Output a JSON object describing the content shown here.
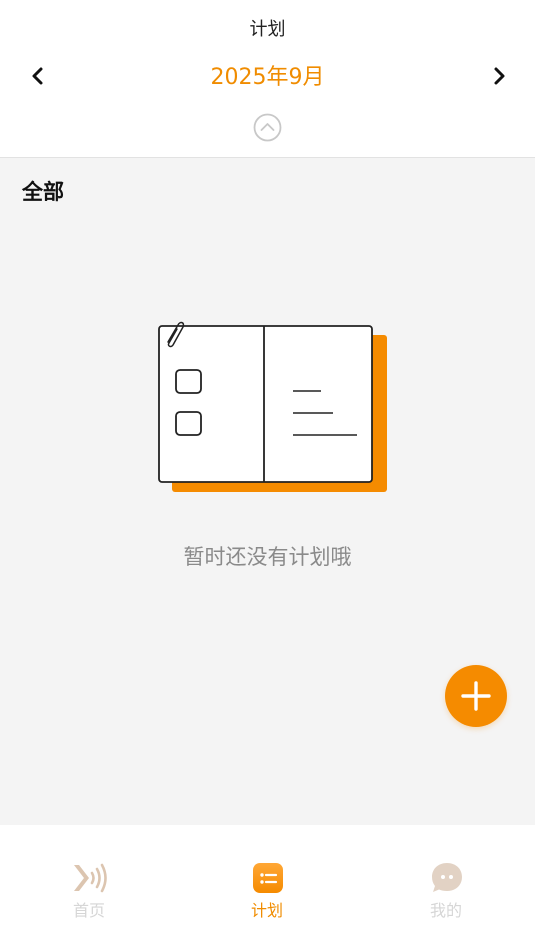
{
  "header": {
    "title": "计划",
    "month_label": "2025年9月",
    "prev_icon": "chevron-left-icon",
    "next_icon": "chevron-right-icon",
    "collapse_icon": "chevron-up-circle-icon"
  },
  "section": {
    "title": "全部"
  },
  "empty_state": {
    "message": "暂时还没有计划哦",
    "illustration": "empty-planner-book"
  },
  "fab": {
    "icon": "plus-icon"
  },
  "tabbar": {
    "items": [
      {
        "label": "首页",
        "icon": "sound-wave-icon",
        "active": false
      },
      {
        "label": "计划",
        "icon": "list-icon",
        "active": true
      },
      {
        "label": "我的",
        "icon": "chat-bubble-icon",
        "active": false
      }
    ]
  },
  "colors": {
    "accent": "#f58b00",
    "background": "#f4f4f4",
    "surface": "#ffffff",
    "muted_text": "#8a8a8a",
    "inactive_tab": "#d6d6d6",
    "inactive_icon": "#dcc5b0"
  }
}
